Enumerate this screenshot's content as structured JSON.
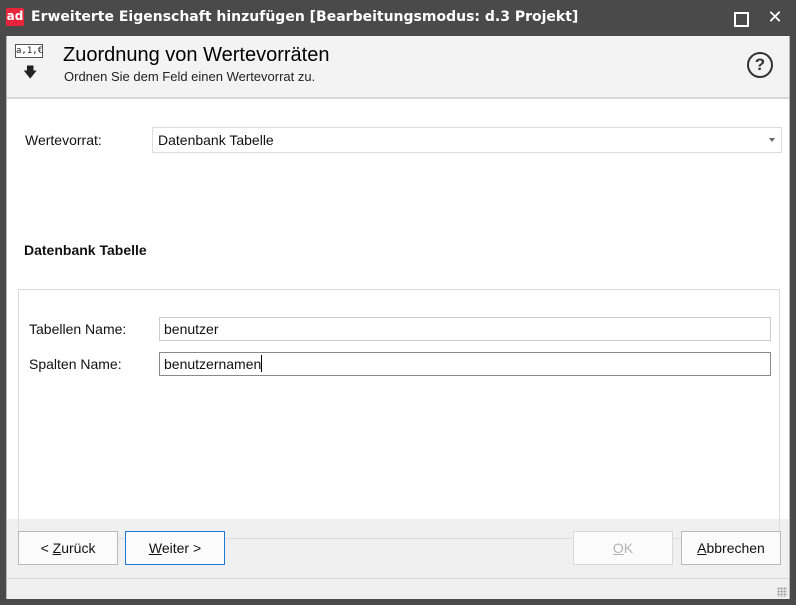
{
  "window": {
    "logo_text": "ad",
    "title": "Erweiterte Eigenschaft hinzufügen  [Bearbeitungsmodus: d.3 Projekt]",
    "maximize_glyph": "",
    "close_glyph": "✕"
  },
  "header": {
    "icon_text": "a,1,€",
    "icon_arrow": "🡇",
    "title": "Zuordnung von Wertevorräten",
    "subtitle": "Ordnen Sie dem Feld einen Wertevorrat zu.",
    "help_glyph": "?"
  },
  "form": {
    "wertevorrat_label": "Wertevorrat:",
    "wertevorrat_value": "Datenbank Tabelle"
  },
  "group": {
    "title": "Datenbank Tabelle",
    "tabellen_label": "Tabellen Name:",
    "tabellen_value": "benutzer",
    "spalten_label": "Spalten Name:",
    "spalten_value": "benutzernamen"
  },
  "buttons": {
    "back": {
      "prefix": "< ",
      "mnemonic": "Z",
      "rest": "urück"
    },
    "next": {
      "mnemonic": "W",
      "rest": "eiter >"
    },
    "ok": {
      "mnemonic": "O",
      "rest": "K"
    },
    "cancel": {
      "mnemonic": "A",
      "rest": "bbrechen"
    }
  }
}
